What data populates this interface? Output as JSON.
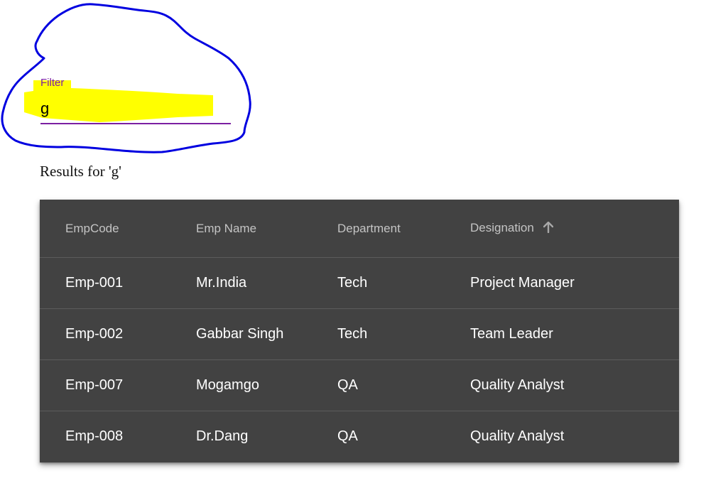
{
  "filter": {
    "label": "Filter",
    "value": "g"
  },
  "results_text": "Results for 'g'",
  "table": {
    "headers": {
      "code": "EmpCode",
      "name": "Emp Name",
      "department": "Department",
      "designation": "Designation"
    },
    "sorted_column": "Designation",
    "sort_icon": "arrow-up-icon",
    "rows": [
      {
        "code": "Emp-001",
        "name": "Mr.India",
        "department": "Tech",
        "designation": "Project Manager"
      },
      {
        "code": "Emp-002",
        "name": "Gabbar Singh",
        "department": "Tech",
        "designation": "Team Leader"
      },
      {
        "code": "Emp-007",
        "name": "Mogamgo",
        "department": "QA",
        "designation": "Quality Analyst"
      },
      {
        "code": "Emp-008",
        "name": "Dr.Dang",
        "department": "QA",
        "designation": "Quality Analyst"
      }
    ]
  },
  "colors": {
    "accent": "#7b1fa2",
    "highlight": "#ffff00",
    "annotation_circle": "#0000e0",
    "table_bg": "#424242"
  }
}
